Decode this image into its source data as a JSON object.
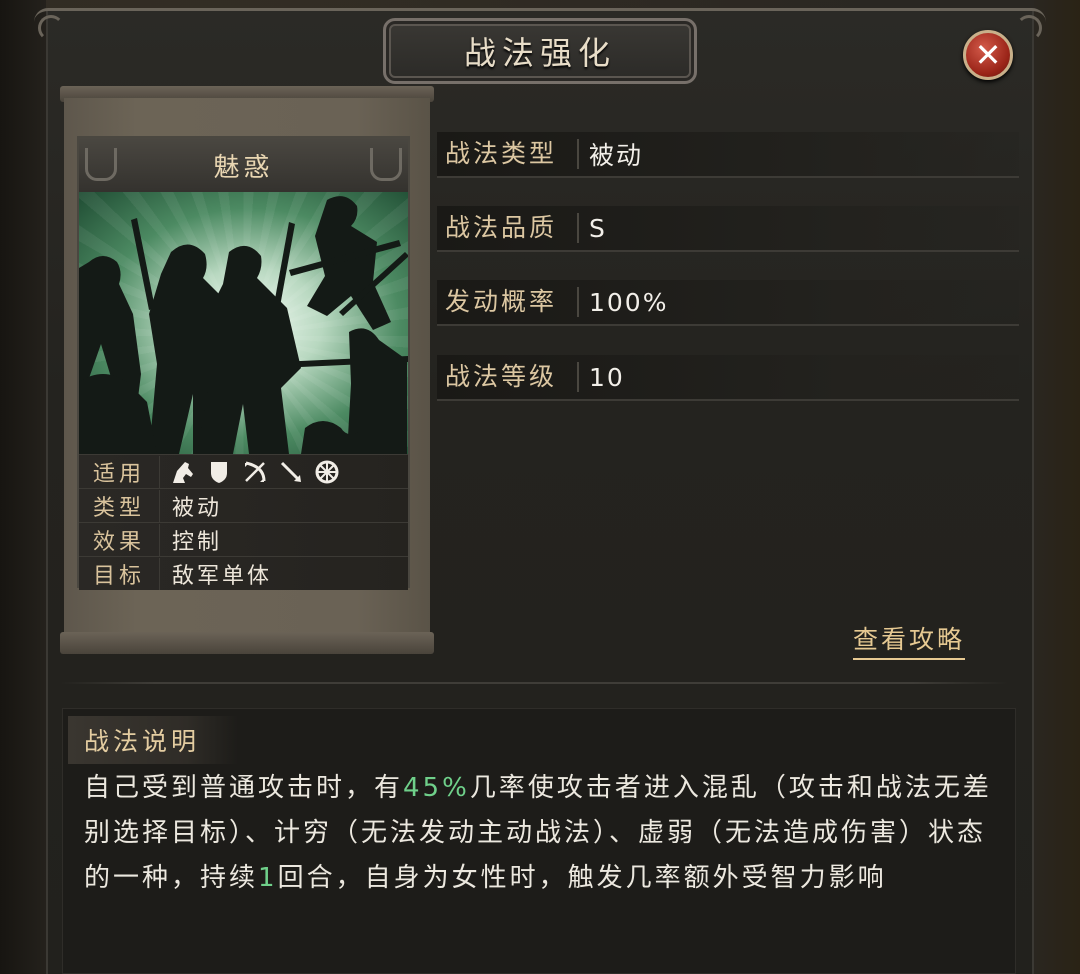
{
  "window": {
    "title": "战法强化",
    "close_label": "✕"
  },
  "card": {
    "name": "魅惑",
    "rows": [
      {
        "key": "适用",
        "value": ""
      },
      {
        "key": "类型",
        "value": "被动"
      },
      {
        "key": "效果",
        "value": "控制"
      },
      {
        "key": "目标",
        "value": "敌军单体"
      }
    ],
    "applicable_icons": [
      "cavalry-icon",
      "shield-icon",
      "archer-icon",
      "spear-icon",
      "wheel-icon"
    ]
  },
  "info": [
    {
      "key": "战法类型",
      "value": "被动"
    },
    {
      "key": "战法品质",
      "value": "S"
    },
    {
      "key": "发动概率",
      "value": "100%"
    },
    {
      "key": "战法等级",
      "value": "10"
    }
  ],
  "guide_link": "查看攻略",
  "description": {
    "header": "战法说明",
    "part1": "自己受到普通攻击时，有",
    "chance": "45%",
    "part2": "几率使攻击者进入混乱（攻击和战法无差别选择目标）、计穷（无法发动主动战法）、虚弱（无法造成伤害）状态的一种，持续",
    "duration": "1",
    "part3": "回合，自身为女性时，触发几率额外受智力影响"
  },
  "colors": {
    "highlight": "#6fd08a",
    "label_gold": "#dcc7a2",
    "close_red": "#9a2418"
  }
}
